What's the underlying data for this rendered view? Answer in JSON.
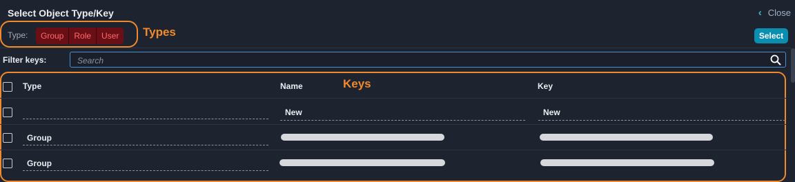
{
  "dialog": {
    "title": "Select Object Type/Key",
    "close_label": "Close",
    "select_label": "Select"
  },
  "type_filter": {
    "label": "Type:",
    "options": [
      "Group",
      "Role",
      "User"
    ]
  },
  "annotations": {
    "types": "Types",
    "keys": "Keys"
  },
  "filter": {
    "label": "Filter keys:",
    "placeholder": "Search"
  },
  "table": {
    "columns": [
      "Type",
      "Name",
      "Key"
    ],
    "rows": [
      {
        "type": "",
        "name": "New",
        "key": "New",
        "redacted": false
      },
      {
        "type": "Group",
        "name": "",
        "key": "",
        "redacted": true
      },
      {
        "type": "Group",
        "name": "",
        "key": "",
        "redacted": true
      }
    ]
  },
  "colors": {
    "background": "#1e2330",
    "annotation": "#f08a2c",
    "accent": "#0a8fb0",
    "segment_text": "#ff6b6b"
  }
}
